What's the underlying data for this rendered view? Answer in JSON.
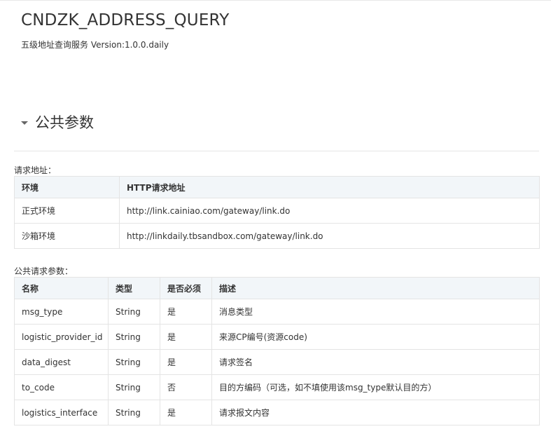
{
  "header": {
    "title": "CNDZK_ADDRESS_QUERY",
    "subtitle": "五级地址查询服务 Version:1.0.0.daily"
  },
  "section": {
    "title": "公共参数",
    "expanded": true
  },
  "address_table": {
    "caption": "请求地址：",
    "columns": [
      "环境",
      "HTTP请求地址"
    ],
    "rows": [
      [
        "正式环境",
        "http://link.cainiao.com/gateway/link.do"
      ],
      [
        "沙箱环境",
        "http://linkdaily.tbsandbox.com/gateway/link.do"
      ]
    ]
  },
  "params_table": {
    "caption": "公共请求参数：",
    "columns": [
      "名称",
      "类型",
      "是否必须",
      "描述"
    ],
    "rows": [
      [
        "msg_type",
        "String",
        "是",
        "消息类型"
      ],
      [
        "logistic_provider_id",
        "String",
        "是",
        "来源CP编号(资源code)"
      ],
      [
        "data_digest",
        "String",
        "是",
        "请求签名"
      ],
      [
        "to_code",
        "String",
        "否",
        "目的方编码（可选，如不填使用该msg_type默认目的方）"
      ],
      [
        "logistics_interface",
        "String",
        "是",
        "请求报文内容"
      ]
    ]
  },
  "colors": {
    "header_bg": "#f2f6f9",
    "border": "#e4e4e4",
    "text": "#333333"
  }
}
